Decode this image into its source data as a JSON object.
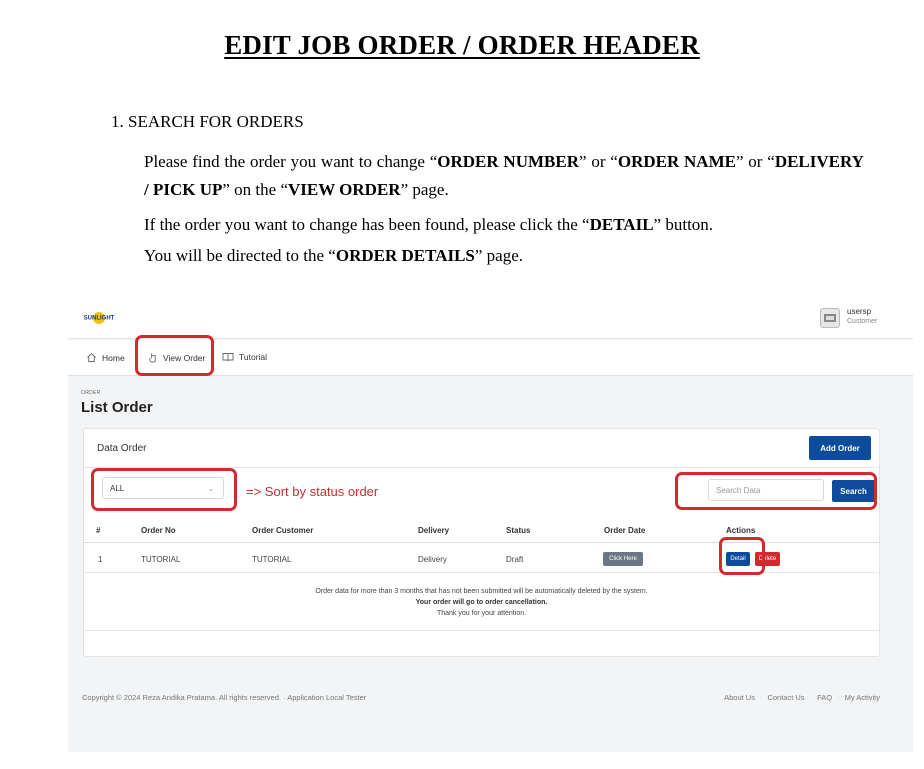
{
  "doc": {
    "title": "EDIT JOB ORDER / ORDER HEADER",
    "step": "1.  SEARCH FOR ORDERS",
    "p1": [
      {
        "t": "Please find the order you want to change “",
        "b": false
      },
      {
        "t": "ORDER NUMBER",
        "b": true
      },
      {
        "t": "” or “",
        "b": false
      },
      {
        "t": "ORDER NAME",
        "b": true
      },
      {
        "t": "” or “",
        "b": false
      },
      {
        "t": "DELIVERY / PICK UP",
        "b": true
      },
      {
        "t": "” on the “",
        "b": false
      },
      {
        "t": "VIEW ORDER",
        "b": true
      },
      {
        "t": "” page.",
        "b": false
      }
    ],
    "p2": [
      {
        "t": "If the order you want to change has been found, please click the “",
        "b": false
      },
      {
        "t": "DETAIL",
        "b": true
      },
      {
        "t": "” button.",
        "b": false
      }
    ],
    "p3": [
      {
        "t": "You will be directed to the “",
        "b": false
      },
      {
        "t": "ORDER DETAILS",
        "b": true
      },
      {
        "t": "” page.",
        "b": false
      }
    ]
  },
  "app": {
    "logo_text": "SUNLIGHT",
    "user": {
      "name": "usersp",
      "role": "Customer"
    },
    "nav": {
      "home": "Home",
      "view_order": "View Order",
      "tutorial": "Tutorial"
    },
    "breadcrumb": "ORDER",
    "page_title": "List Order",
    "card": {
      "title": "Data Order",
      "add_button": "Add Order",
      "status_filter": "ALL",
      "sort_note": "=> Sort by status order",
      "search_placeholder": "Search Data",
      "search_button": "Search",
      "columns": [
        "#",
        "Order No",
        "Order Customer",
        "Delivery",
        "Status",
        "Order Date",
        "Actions"
      ],
      "row": {
        "num": "1",
        "order_no": "TUTORIAL",
        "customer": "TUTORIAL",
        "delivery": "Delivery",
        "status": "Draft",
        "date_button": "Click Here",
        "detail_button": "Detail",
        "delete_button": "Delete"
      },
      "notice": [
        "Order data for more than 3 months that has not been submitted will be automatically deleted by the system.",
        "Your order will go to order cancellation.",
        "Thank you for your attention."
      ]
    },
    "footer": {
      "copyright": "Copyright © 2024 Reza Andika Pratama. All rights reserved.  ·  Application Local Tester",
      "links": [
        "About Us",
        "Contact Us",
        "FAQ",
        "My Activity"
      ]
    },
    "colors": {
      "primary": "#0d4c9c",
      "highlight": "#d12a2f",
      "danger": "#d12a2f",
      "neutral_button": "#6b7784"
    }
  }
}
